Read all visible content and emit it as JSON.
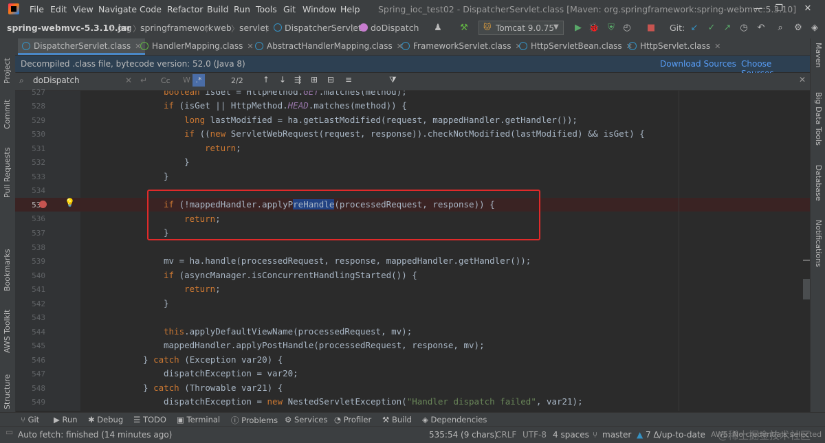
{
  "window": {
    "title": "Spring_ioc_test02 - DispatcherServlet.class [Maven: org.springframework:spring-webmvc:5.3.10]",
    "menu": [
      "File",
      "Edit",
      "View",
      "Navigate",
      "Code",
      "Refactor",
      "Build",
      "Run",
      "Tools",
      "Git",
      "Window",
      "Help"
    ]
  },
  "breadcrumb": {
    "jar": "spring-webmvc-5.3.10.jar",
    "items": [
      "org",
      "springframework",
      "web",
      "servlet"
    ],
    "class": "DispatcherServlet",
    "method": "doDispatch"
  },
  "toolbar": {
    "run_config": "Tomcat 9.0.75",
    "git_label": "Git:"
  },
  "tabs": [
    {
      "label": "DispatcherServlet.class",
      "active": true
    },
    {
      "label": "HandlerMapping.class",
      "active": false
    },
    {
      "label": "AbstractHandlerMapping.class",
      "active": false
    },
    {
      "label": "FrameworkServlet.class",
      "active": false
    },
    {
      "label": "HttpServletBean.class",
      "active": false
    },
    {
      "label": "HttpServlet.class",
      "active": false
    }
  ],
  "banner": {
    "message": "Decompiled .class file, bytecode version: 52.0 (Java 8)",
    "download": "Download Sources",
    "choose": "Choose Sources..."
  },
  "search": {
    "query": "doDispatch",
    "case_label": "Cc",
    "count": "2/2"
  },
  "left_tools": [
    "Project",
    "Commit",
    "Pull Requests",
    "Bookmarks",
    "AWS Toolkit",
    "Structure"
  ],
  "right_tools": [
    "Maven",
    "Big Data Tools",
    "Database",
    "Notifications"
  ],
  "code": {
    "line_numbers": [
      "527",
      "528",
      "529",
      "530",
      "531",
      "532",
      "533",
      "534",
      "535",
      "536",
      "537",
      "538",
      "539",
      "540",
      "541",
      "542",
      "543",
      "544",
      "545",
      "546",
      "547",
      "548",
      "549"
    ],
    "breakpoint_line": "535"
  },
  "bottom_tools": [
    "Git",
    "Run",
    "Debug",
    "TODO",
    "Terminal",
    "Problems",
    "Services",
    "Profiler",
    "Build",
    "Dependencies"
  ],
  "status": {
    "left": "Auto fetch: finished (14 minutes ago)",
    "position": "535:54 (9 chars)",
    "line_sep": "CRLF",
    "encoding": "UTF-8",
    "indent": "4 spaces",
    "branch": "master",
    "git_state": "7 Δ/up-to-date",
    "aws": "AWS: No credentials selected",
    "watermark": "@稀土掘金技术社区"
  },
  "colors": {
    "highlight_box": "#e02a2a",
    "breakpoint": "#c75450",
    "selection": "#214283"
  }
}
